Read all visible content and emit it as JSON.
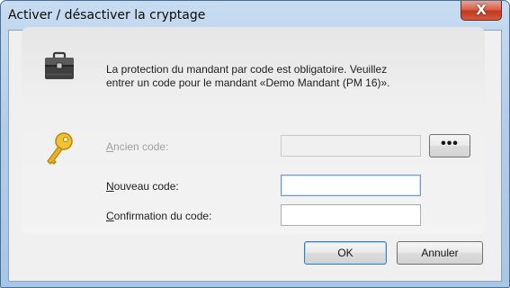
{
  "window": {
    "title": "Activer / désactiver la cryptage",
    "close_glyph": "X"
  },
  "message": {
    "line1": "La protection du mandant par code est obligatoire. Veuillez",
    "line2": "entrer un code pour le mandant «Demo Mandant (PM 16)»."
  },
  "form": {
    "old_code": {
      "mnemonic": "A",
      "rest": "ncien code:",
      "value": "",
      "enabled": false
    },
    "browse_glyph": "•••",
    "new_code": {
      "mnemonic": "N",
      "rest": "ouveau code:",
      "value": ""
    },
    "confirm_code": {
      "mnemonic": "C",
      "rest": "onfirmation du code:",
      "value": ""
    }
  },
  "buttons": {
    "ok": "OK",
    "cancel": "Annuler"
  },
  "icons": {
    "info": "briefcase-icon",
    "key": "key-icon",
    "close": "close-icon"
  },
  "colors": {
    "title_bar": "#b3cce8",
    "close_button": "#c1391f",
    "key": "#f2c233",
    "panel": "#eeeeee"
  }
}
